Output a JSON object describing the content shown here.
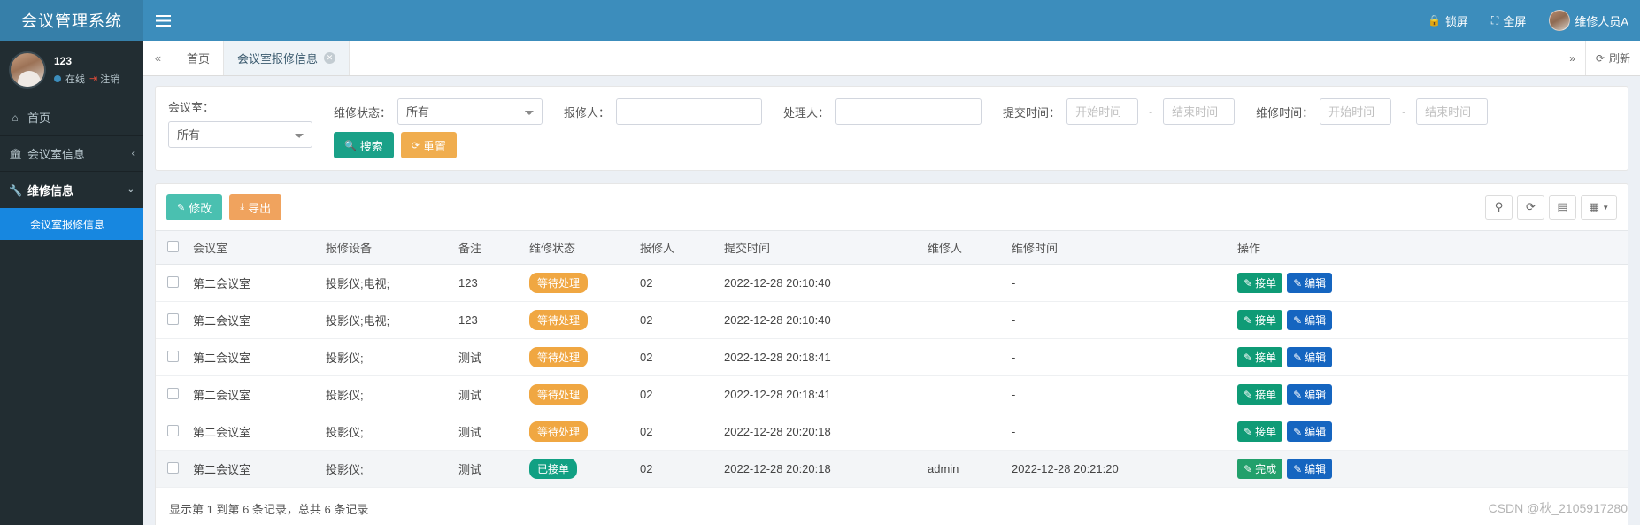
{
  "header": {
    "logo": "会议管理系统",
    "menu_icon": "hamburger-icon",
    "lock_label": "锁屏",
    "fullscreen_label": "全屏",
    "user_label": "维修人员A"
  },
  "sidebar": {
    "user": {
      "name": "123",
      "status": "在线",
      "logout": "注销"
    },
    "items": [
      {
        "label": "首页",
        "icon": "home-icon",
        "arrow": ""
      },
      {
        "label": "会议室信息",
        "icon": "bank-icon",
        "arrow": "‹"
      },
      {
        "label": "维修信息",
        "icon": "wrench-icon",
        "arrow": "⌄"
      }
    ],
    "submenu": [
      {
        "label": "会议室报修信息"
      }
    ]
  },
  "tabstrip": {
    "prev_icon": "double-chevron-left-icon",
    "next_icon": "double-chevron-right-icon",
    "tabs": [
      {
        "label": "首页",
        "active": false,
        "closable": false
      },
      {
        "label": "会议室报修信息",
        "active": true,
        "closable": true
      }
    ],
    "refresh_label": "刷新",
    "refresh_icon": "refresh-icon"
  },
  "filters": {
    "room": {
      "label": "会议室：",
      "value": "所有"
    },
    "status": {
      "label": "维修状态：",
      "value": "所有"
    },
    "reporter": {
      "label": "报修人：",
      "value": "",
      "placeholder": ""
    },
    "handler": {
      "label": "处理人：",
      "value": "",
      "placeholder": ""
    },
    "submit_time": {
      "label": "提交时间：",
      "start_placeholder": "开始时间",
      "end_placeholder": "结束时间",
      "separator": "-"
    },
    "repair_time": {
      "label": "维修时间：",
      "start_placeholder": "开始时间",
      "end_placeholder": "结束时间",
      "separator": "-"
    },
    "search_button": {
      "label": "搜索",
      "icon": "search-icon"
    },
    "reset_button": {
      "label": "重置",
      "icon": "refresh-icon"
    }
  },
  "toolbar": {
    "modify_button": {
      "label": "修改",
      "icon": "edit-icon"
    },
    "export_button": {
      "label": "导出",
      "icon": "download-icon"
    },
    "icons": [
      {
        "name": "search-icon",
        "glyph": "⚲"
      },
      {
        "name": "refresh-icon",
        "glyph": "⟳"
      },
      {
        "name": "toggle-view-icon",
        "glyph": "▤"
      },
      {
        "name": "columns-icon",
        "glyph": "▦"
      }
    ]
  },
  "table": {
    "columns": [
      "会议室",
      "报修设备",
      "备注",
      "维修状态",
      "报修人",
      "提交时间",
      "维修人",
      "维修时间",
      "操作"
    ],
    "rows": [
      {
        "room": "第二会议室",
        "equipment": "投影仪;电视;",
        "note": "123",
        "status": "等待处理",
        "status_type": "wait",
        "reporter": "02",
        "submit_time": "2022-12-28 20:10:40",
        "repairer": "",
        "repair_time": "-",
        "actions": [
          {
            "label": "接单",
            "type": "accept"
          },
          {
            "label": "编辑",
            "type": "edit"
          }
        ],
        "highlight": false
      },
      {
        "room": "第二会议室",
        "equipment": "投影仪;电视;",
        "note": "123",
        "status": "等待处理",
        "status_type": "wait",
        "reporter": "02",
        "submit_time": "2022-12-28 20:10:40",
        "repairer": "",
        "repair_time": "-",
        "actions": [
          {
            "label": "接单",
            "type": "accept"
          },
          {
            "label": "编辑",
            "type": "edit"
          }
        ],
        "highlight": false
      },
      {
        "room": "第二会议室",
        "equipment": "投影仪;",
        "note": "测试",
        "status": "等待处理",
        "status_type": "wait",
        "reporter": "02",
        "submit_time": "2022-12-28 20:18:41",
        "repairer": "",
        "repair_time": "-",
        "actions": [
          {
            "label": "接单",
            "type": "accept"
          },
          {
            "label": "编辑",
            "type": "edit"
          }
        ],
        "highlight": false
      },
      {
        "room": "第二会议室",
        "equipment": "投影仪;",
        "note": "测试",
        "status": "等待处理",
        "status_type": "wait",
        "reporter": "02",
        "submit_time": "2022-12-28 20:18:41",
        "repairer": "",
        "repair_time": "-",
        "actions": [
          {
            "label": "接单",
            "type": "accept"
          },
          {
            "label": "编辑",
            "type": "edit"
          }
        ],
        "highlight": false
      },
      {
        "room": "第二会议室",
        "equipment": "投影仪;",
        "note": "测试",
        "status": "等待处理",
        "status_type": "wait",
        "reporter": "02",
        "submit_time": "2022-12-28 20:20:18",
        "repairer": "",
        "repair_time": "-",
        "actions": [
          {
            "label": "接单",
            "type": "accept"
          },
          {
            "label": "编辑",
            "type": "edit"
          }
        ],
        "highlight": false
      },
      {
        "room": "第二会议室",
        "equipment": "投影仪;",
        "note": "测试",
        "status": "已接单",
        "status_type": "taken",
        "reporter": "02",
        "submit_time": "2022-12-28 20:20:18",
        "repairer": "admin",
        "repair_time": "2022-12-28 20:21:20",
        "actions": [
          {
            "label": "完成",
            "type": "done"
          },
          {
            "label": "编辑",
            "type": "edit"
          }
        ],
        "highlight": true
      }
    ],
    "footer": "显示第 1 到第 6 条记录，总共 6 条记录"
  },
  "watermark": "CSDN @秋_2105917280",
  "colors": {
    "header_blue": "#3c8dbc",
    "logo_blue": "#367fa9",
    "sidebar_dark": "#222d32",
    "submenu_active": "#1787e0",
    "teal": "#1aa188",
    "orange": "#f0ad4e",
    "badge_wait": "#f0a742",
    "badge_taken": "#11a083",
    "edit_blue": "#1565c0"
  }
}
